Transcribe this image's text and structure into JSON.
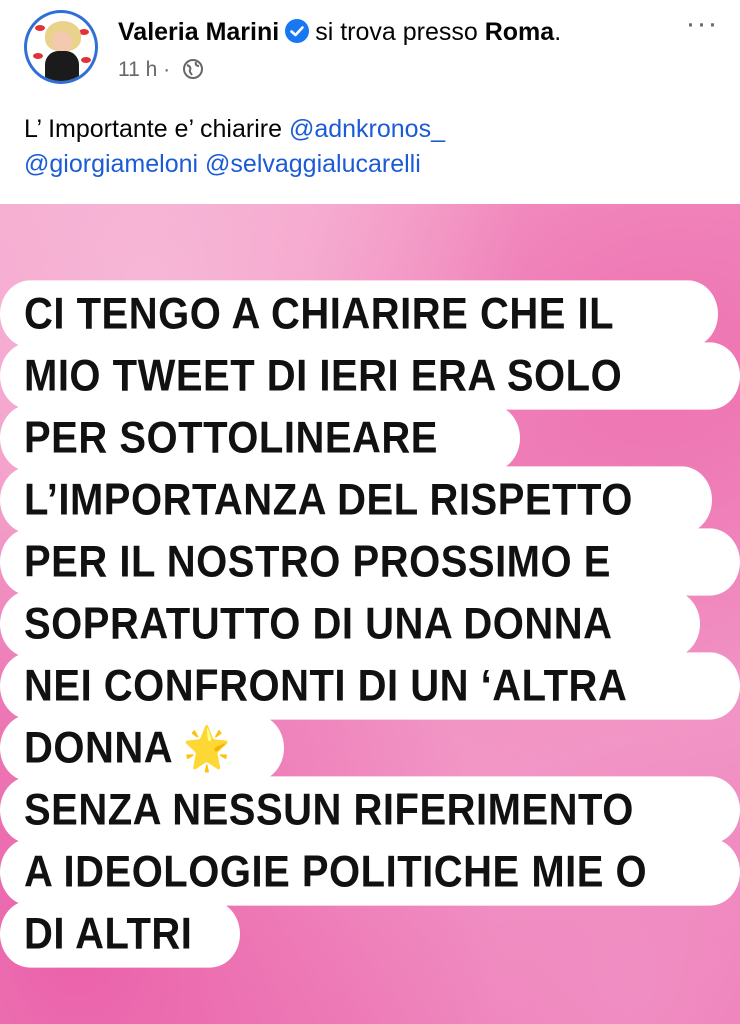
{
  "post": {
    "author": "Valeria Marini",
    "location_prefix": "si trova presso",
    "location": "Roma",
    "location_suffix": ".",
    "time": "11 h",
    "separator": "·",
    "more": "···",
    "text": "L’ Importante e’ chiarire ",
    "mentions": [
      "@adnkronos_",
      "@giorgiameloni",
      "@selvaggialucarelli"
    ]
  },
  "icons": {
    "verified": "verified-badge-icon",
    "audience": "globe-icon",
    "more": "more-options-icon",
    "star": "glowing-star-emoji"
  },
  "story": {
    "lines": [
      "CI TENGO A CHIARIRE CHE IL",
      "MIO TWEET DI IERI ERA SOLO",
      "PER SOTTOLINEARE",
      "L’IMPORTANZA DEL RISPETTO",
      "PER IL  NOSTRO PROSSIMO  E",
      "SOPRATUTTO DI UNA DONNA",
      "NEI CONFRONTI DI UN ‘ALTRA",
      "DONNA",
      "SENZA NESSUN RIFERIMENTO",
      "A IDEOLOGIE  POLITICHE MIE O",
      "DI ALTRI"
    ],
    "star_emoji": "🌟"
  },
  "colors": {
    "mention": "#1c5bd6",
    "verified": "#1877f2",
    "meta": "#65676b",
    "background_pink": "#ef86bc"
  }
}
